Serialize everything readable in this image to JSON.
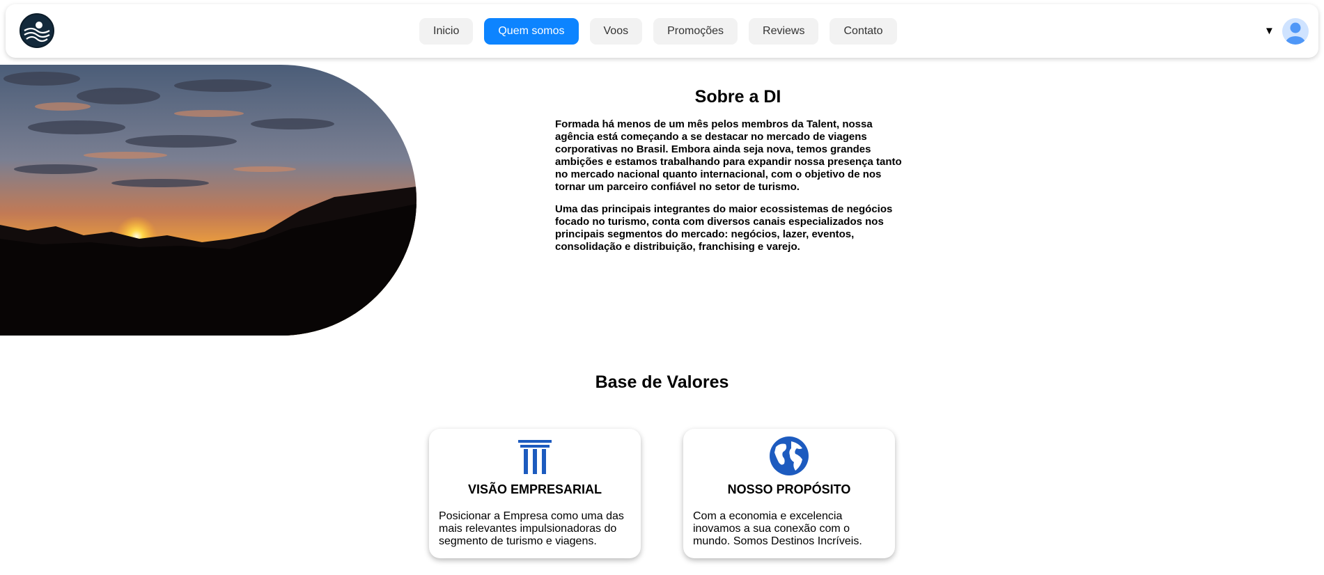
{
  "header": {
    "nav_items": [
      {
        "label": "Inicio",
        "active": false
      },
      {
        "label": "Quem somos",
        "active": true
      },
      {
        "label": "Voos",
        "active": false
      },
      {
        "label": "Promoções",
        "active": false
      },
      {
        "label": "Reviews",
        "active": false
      },
      {
        "label": "Contato",
        "active": false
      }
    ],
    "dropdown_icon": "▼",
    "avatar_icon": "user-avatar-icon",
    "accent_color": "#0d84ff"
  },
  "hero": {
    "image": "sunset-mountains"
  },
  "about": {
    "title": "Sobre a DI",
    "paragraphs": [
      "Formada há menos de um mês pelos membros da Talent, nossa agência está começando a se destacar no mercado de viagens corporativas no Brasil. Embora ainda seja nova, temos grandes ambições e estamos trabalhando para expandir nossa presença tanto no mercado nacional quanto internacional, com o objetivo de nos tornar um parceiro confiável no setor de turismo.",
      "Uma das principais integrantes do maior ecossistemas de negócios focado no turismo, conta com diversos canais especializados nos principais segmentos do mercado: negócios, lazer, eventos, consolidação e distribuição, franchising e varejo."
    ]
  },
  "values": {
    "title": "Base de Valores",
    "icon_color": "#1d5bbf",
    "cards": [
      {
        "icon": "column-icon",
        "title": "VISÃO EMPRESARIAL",
        "text": "Posicionar a Empresa como uma das mais relevantes impulsionadoras do segmento de turismo e viagens."
      },
      {
        "icon": "globe-icon",
        "title": "NOSSO PROPÓSITO",
        "text": "Com a economia e excelencia inovamos a sua conexão com o mundo. Somos Destinos Incríveis."
      }
    ]
  }
}
